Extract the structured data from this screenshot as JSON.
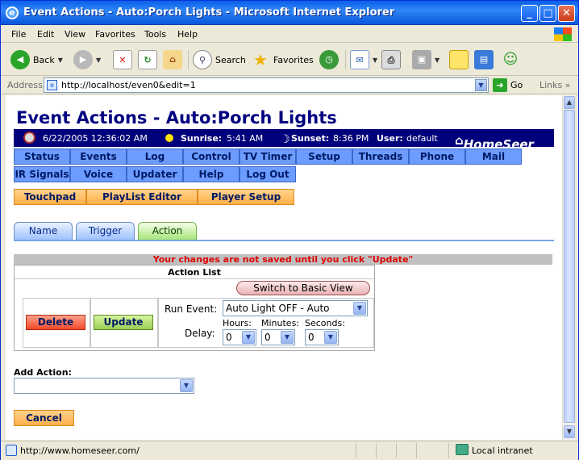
{
  "window": {
    "title": "Event Actions - Auto:Porch Lights - Microsoft Internet Explorer",
    "minimize": "_",
    "maximize": "□",
    "close": "✕"
  },
  "menu": [
    "File",
    "Edit",
    "View",
    "Favorites",
    "Tools",
    "Help"
  ],
  "toolbar": {
    "back": "Back",
    "search": "Search",
    "favorites": "Favorites"
  },
  "address": {
    "label": "Address",
    "url": "http://localhost/even0&edit=1",
    "go": "Go",
    "links": "Links"
  },
  "page": {
    "title": "Event Actions - Auto:Porch Lights",
    "info": {
      "datetime": "6/22/2005 12:36:02 AM",
      "sunrise_label": "Sunrise:",
      "sunrise": "5:41 AM",
      "sunset_label": "Sunset:",
      "sunset": "8:36 PM",
      "user_label": "User:",
      "user": "default",
      "logo": "HomeSeer"
    },
    "nav_row1": [
      "Status",
      "Events",
      "Log",
      "Control",
      "TV Timer",
      "Setup",
      "Threads",
      "Phone",
      "Mail"
    ],
    "nav_row2": [
      "IR Signals",
      "Voice",
      "Updater",
      "Help",
      "Log Out"
    ],
    "nav_row3": [
      "Touchpad",
      "PlayList Editor",
      "Player Setup"
    ],
    "tabs": [
      "Name",
      "Trigger",
      "Action"
    ],
    "active_tab": "Action",
    "warning": "Your changes are not saved until you click \"Update\"",
    "action_list": {
      "header": "Action List",
      "basic_view_button": "Switch to Basic View",
      "delete": "Delete",
      "update": "Update",
      "run_event_label": "Run Event:",
      "run_event_value": "Auto Light OFF - Auto",
      "delay_label": "Delay:",
      "hours_label": "Hours:",
      "minutes_label": "Minutes:",
      "seconds_label": "Seconds:",
      "hours": "0",
      "minutes": "0",
      "seconds": "0"
    },
    "add_action_label": "Add Action:",
    "add_action_value": "",
    "cancel": "Cancel"
  },
  "status": {
    "text": "http://www.homeseer.com/",
    "zone": "Local intranet"
  },
  "colors": {
    "title_blue": "#000080",
    "info_bar": "#00007a",
    "nav_blue": "#6c9cff",
    "nav_orange": "#ffb04a",
    "warning_red": "#e00000"
  }
}
